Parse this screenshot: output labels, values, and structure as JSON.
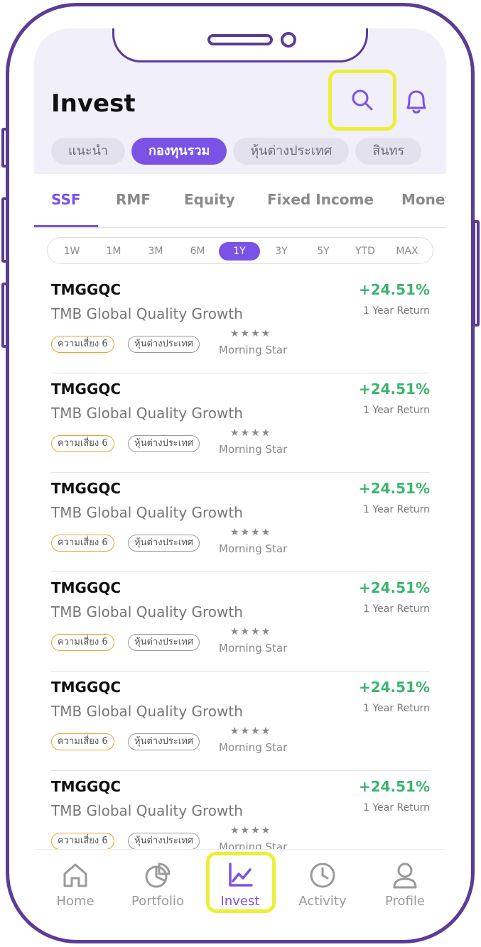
{
  "header": {
    "title": "Invest",
    "chips": [
      {
        "label": "แนะนำ",
        "active": false
      },
      {
        "label": "กองทุนรวม",
        "active": true
      },
      {
        "label": "หุ้นต่างประเทศ",
        "active": false
      },
      {
        "label": "สินทร",
        "active": false
      }
    ]
  },
  "category_tabs": [
    {
      "label": "SSF",
      "active": true
    },
    {
      "label": "RMF",
      "active": false
    },
    {
      "label": "Equity",
      "active": false
    },
    {
      "label": "Fixed Income",
      "active": false
    },
    {
      "label": "Money",
      "active": false
    }
  ],
  "periods": [
    {
      "label": "1W",
      "active": false
    },
    {
      "label": "1M",
      "active": false
    },
    {
      "label": "3M",
      "active": false
    },
    {
      "label": "6M",
      "active": false
    },
    {
      "label": "1Y",
      "active": true
    },
    {
      "label": "3Y",
      "active": false
    },
    {
      "label": "5Y",
      "active": false
    },
    {
      "label": "YTD",
      "active": false
    },
    {
      "label": "MAX",
      "active": false
    }
  ],
  "funds": [
    {
      "code": "TMGGQC",
      "name": "TMB Global Quality Growth",
      "return": "+24.51%",
      "return_label": "1 Year Return",
      "risk_badge": "ความเสี่ยง 6",
      "region_badge": "หุ้นต่างประเทศ",
      "stars": "★★★★",
      "rating_label": "Morning Star"
    },
    {
      "code": "TMGGQC",
      "name": "TMB Global Quality Growth",
      "return": "+24.51%",
      "return_label": "1 Year Return",
      "risk_badge": "ความเสี่ยง 6",
      "region_badge": "หุ้นต่างประเทศ",
      "stars": "★★★★",
      "rating_label": "Morning Star"
    },
    {
      "code": "TMGGQC",
      "name": "TMB Global Quality Growth",
      "return": "+24.51%",
      "return_label": "1 Year Return",
      "risk_badge": "ความเสี่ยง 6",
      "region_badge": "หุ้นต่างประเทศ",
      "stars": "★★★★",
      "rating_label": "Morning Star"
    },
    {
      "code": "TMGGQC",
      "name": "TMB Global Quality Growth",
      "return": "+24.51%",
      "return_label": "1 Year Return",
      "risk_badge": "ความเสี่ยง 6",
      "region_badge": "หุ้นต่างประเทศ",
      "stars": "★★★★",
      "rating_label": "Morning Star"
    },
    {
      "code": "TMGGQC",
      "name": "TMB Global Quality Growth",
      "return": "+24.51%",
      "return_label": "1 Year Return",
      "risk_badge": "ความเสี่ยง 6",
      "region_badge": "หุ้นต่างประเทศ",
      "stars": "★★★★",
      "rating_label": "Morning Star"
    },
    {
      "code": "TMGGQC",
      "name": "TMB Global Quality Growth",
      "return": "+24.51%",
      "return_label": "1 Year Return",
      "risk_badge": "ความเสี่ยง 6",
      "region_badge": "หุ้นต่างประเทศ",
      "stars": "★★★★",
      "rating_label": "Morning Star"
    }
  ],
  "bottom_nav": [
    {
      "label": "Home",
      "icon": "home-icon",
      "active": false
    },
    {
      "label": "Portfolio",
      "icon": "pie-chart-icon",
      "active": false
    },
    {
      "label": "Invest",
      "icon": "line-chart-icon",
      "active": true
    },
    {
      "label": "Activity",
      "icon": "clock-icon",
      "active": false
    },
    {
      "label": "Profile",
      "icon": "user-icon",
      "active": false
    }
  ],
  "colors": {
    "accent": "#7a52e6",
    "positive": "#3cb46e",
    "highlight": "#eaf039",
    "frame": "#5b3c96",
    "risk_badge_border": "#f2a12a"
  }
}
